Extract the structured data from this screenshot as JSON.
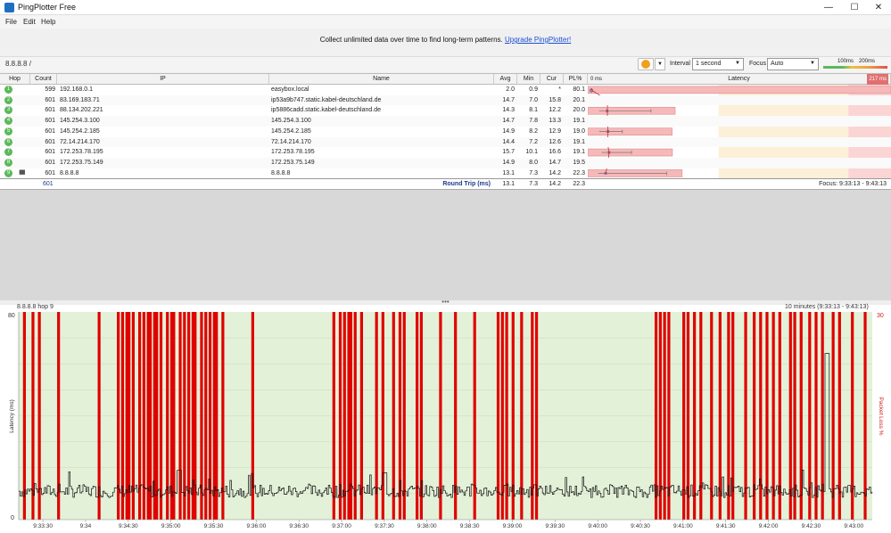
{
  "window": {
    "title": "PingPlotter Free",
    "minimize": "—",
    "maximize": "☐",
    "close": "✕"
  },
  "menu": [
    "File",
    "Edit",
    "Help"
  ],
  "promo": {
    "text": "Collect unlimited data over time to find long-term patterns.",
    "link": "Upgrade PingPlotter!"
  },
  "toolbar": {
    "target": "8.8.8.8 /",
    "interval_label": "Interval",
    "interval_value": "1 second",
    "focus_label": "Focus",
    "focus_value": "Auto",
    "scale_100": "100ms",
    "scale_200": "200ms"
  },
  "columns": {
    "hop": "Hop",
    "count": "Count",
    "ip": "IP",
    "name": "Name",
    "avg": "Avg",
    "min": "Min",
    "cur": "Cur",
    "pl": "PL%",
    "latency": "Latency",
    "lat_min": "0 ms",
    "lat_max": "217 ms"
  },
  "hops": [
    {
      "hop": "1",
      "count": "599",
      "ip": "192.168.0.1",
      "name": "easybox.local",
      "avg": "2.0",
      "min": "0.9",
      "cur": "*",
      "pl": "80.1",
      "avg_ms": 2.0,
      "min_ms": 0.9,
      "max_ms": 2.5,
      "pl_value": 80.1
    },
    {
      "hop": "2",
      "count": "601",
      "ip": "83.169.183.71",
      "name": "ip53a9b747.static.kabel-deutschland.de",
      "avg": "14.7",
      "min": "7.0",
      "cur": "15.8",
      "pl": "20.1",
      "avg_ms": 14.7,
      "min_ms": 7.0,
      "max_ms": 217,
      "pl_value": 20.1
    },
    {
      "hop": "3",
      "count": "601",
      "ip": "88.134.202.221",
      "name": "ip5886cadd.static.kabel-deutschland.de",
      "avg": "14.3",
      "min": "8.1",
      "cur": "12.2",
      "pl": "20.0",
      "avg_ms": 14.3,
      "min_ms": 8.1,
      "max_ms": 48,
      "pl_value": 20.0
    },
    {
      "hop": "4",
      "count": "601",
      "ip": "145.254.3.100",
      "name": "145.254.3.100",
      "avg": "14.7",
      "min": "7.8",
      "cur": "13.3",
      "pl": "19.1",
      "avg_ms": 14.7,
      "min_ms": 7.8,
      "max_ms": 33,
      "pl_value": 19.1
    },
    {
      "hop": "5",
      "count": "601",
      "ip": "145.254.2.185",
      "name": "145.254.2.185",
      "avg": "14.9",
      "min": "8.2",
      "cur": "12.9",
      "pl": "19.0",
      "avg_ms": 14.9,
      "min_ms": 8.2,
      "max_ms": 26,
      "pl_value": 19.0
    },
    {
      "hop": "6",
      "count": "601",
      "ip": "72.14.214.170",
      "name": "72.14.214.170",
      "avg": "14.4",
      "min": "7.2",
      "cur": "12.6",
      "pl": "19.1",
      "avg_ms": 14.4,
      "min_ms": 7.2,
      "max_ms": 30,
      "pl_value": 19.1
    },
    {
      "hop": "7",
      "count": "601",
      "ip": "172.253.78.195",
      "name": "172.253.78.195",
      "avg": "15.7",
      "min": "10.1",
      "cur": "16.6",
      "pl": "19.1",
      "avg_ms": 15.7,
      "min_ms": 10.1,
      "max_ms": 33,
      "pl_value": 19.1
    },
    {
      "hop": "8",
      "count": "601",
      "ip": "172.253.75.149",
      "name": "172.253.75.149",
      "avg": "14.9",
      "min": "8.0",
      "cur": "14.7",
      "pl": "19.5",
      "avg_ms": 14.9,
      "min_ms": 8.0,
      "max_ms": 45,
      "pl_value": 19.5
    },
    {
      "hop": "9",
      "count": "601",
      "ip": "8.8.8.8",
      "name": "8.8.8.8",
      "avg": "13.1",
      "min": "7.3",
      "cur": "14.2",
      "pl": "22.3",
      "avg_ms": 13.1,
      "min_ms": 7.3,
      "max_ms": 60,
      "pl_value": 22.3
    }
  ],
  "summary": {
    "count": "601",
    "label": "Round Trip (ms)",
    "avg": "13.1",
    "min": "7.3",
    "cur": "14.2",
    "pl": "22.3",
    "focus": "Focus: 9:33:13 - 9:43:13"
  },
  "splitter": "•••",
  "timeline": {
    "title": "8.8.8.8 hop 9",
    "range": "10 minutes (9:33:13 - 9:43:13)",
    "ylabel": "Latency (ms)",
    "y2label": "Packet Loss %",
    "ymax": "80",
    "ymin": "0",
    "y2max": "30",
    "xticks": [
      "9:33:30",
      "9:34",
      "9:34:30",
      "9:35:00",
      "9:35:30",
      "9:36:00",
      "9:36:30",
      "9:37:00",
      "9:37:30",
      "9:38:00",
      "9:38:30",
      "9:39:00",
      "9:39:30",
      "9:40:00",
      "9:40:30",
      "9:41:00",
      "9:41:30",
      "9:42:00",
      "9:42:30",
      "9:43:00"
    ]
  },
  "chart_data": {
    "type": "line",
    "title": "8.8.8.8 hop 9",
    "subtitle": "10 minutes (9:33:13 - 9:43:13)",
    "xlabel": "",
    "ylabel": "Latency (ms)",
    "y2label": "Packet Loss %",
    "ylim": [
      0,
      80
    ],
    "y2lim": [
      0,
      30
    ],
    "x_start": "9:33:13",
    "x_end": "9:43:13",
    "series": [
      {
        "name": "",
        "seed": 7,
        "baseline_ms": 11,
        "spikes": [
          {
            "t": "9:35:05",
            "ms": 19
          },
          {
            "t": "9:37:30",
            "ms": 18
          },
          {
            "t": "9:42:41",
            "ms": 64
          }
        ]
      }
    ],
    "packet_loss_bars_minutes": [
      0.1,
      0.3,
      0.45,
      0.9,
      1.85,
      2.3,
      2.4,
      2.5,
      2.55,
      2.65,
      2.8,
      2.9,
      3.0,
      3.05,
      3.15,
      3.2,
      3.3,
      3.45,
      3.55,
      3.6,
      3.75,
      3.85,
      3.95,
      4.05,
      4.1,
      4.25,
      4.35,
      4.45,
      4.55,
      4.6,
      4.75,
      5.45,
      7.35,
      7.5,
      7.6,
      7.7,
      7.75,
      7.85,
      8.0,
      8.35,
      8.5,
      8.75,
      8.9,
      9.0,
      9.3,
      9.4,
      9.85,
      10.2,
      10.65,
      11.2,
      11.3,
      11.4,
      11.55,
      11.75,
      12.0,
      12.1,
      14.9,
      15.0,
      15.1,
      15.2,
      15.55,
      15.65,
      15.8,
      15.95,
      16.2,
      16.4,
      16.6,
      16.7,
      17.0,
      17.2,
      17.35,
      17.5,
      17.65,
      17.8,
      18.05,
      18.15,
      18.3,
      18.5,
      18.65,
      18.8,
      19.05,
      19.2,
      19.5,
      19.8
    ]
  }
}
